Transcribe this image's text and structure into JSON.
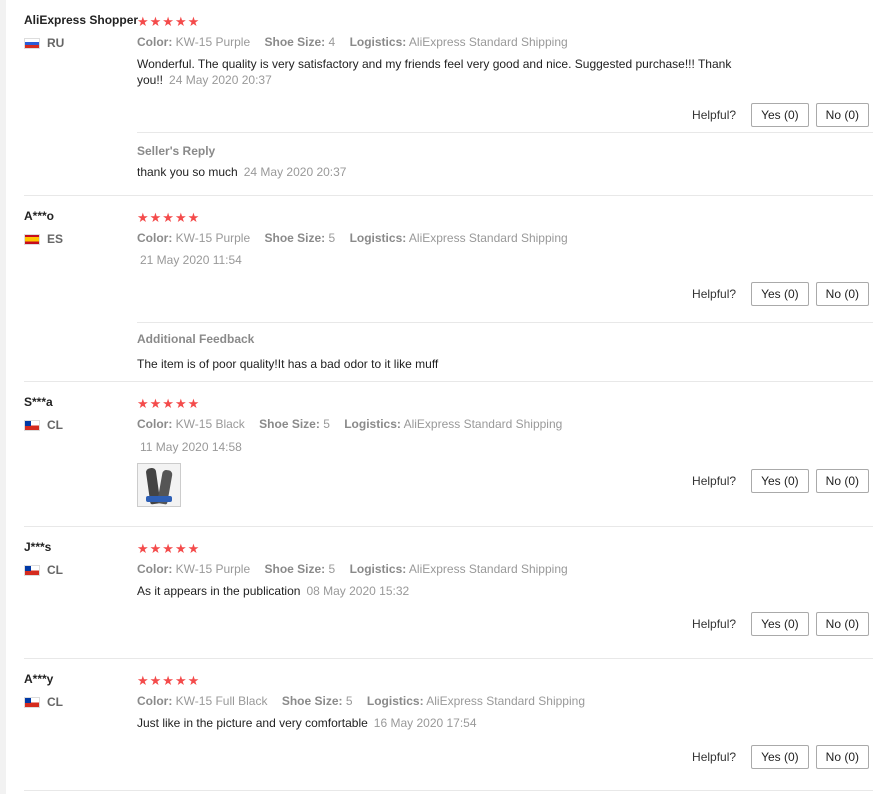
{
  "labels": {
    "color": "Color:",
    "shoe_size": "Shoe Size:",
    "logistics": "Logistics:",
    "helpful": "Helpful?",
    "yes": "Yes (0)",
    "no": "No (0)",
    "stars": "★★★★★"
  },
  "reviews": [
    {
      "user": "AliExpress Shopper",
      "country": "RU",
      "color": "KW-15 Purple",
      "shoe_size": "4",
      "logistics": "AliExpress Standard Shipping",
      "text": "Wonderful. The quality is very satisfactory and my friends feel very good and nice. Suggested purchase!!! Thank you!!",
      "date": "24 May 2020 20:37",
      "seller_reply": {
        "title": "Seller's Reply",
        "text": "thank you so much",
        "date": "24 May 2020 20:37"
      }
    },
    {
      "user": "A***o",
      "country": "ES",
      "color": "KW-15 Purple",
      "shoe_size": "5",
      "logistics": "AliExpress Standard Shipping",
      "text": "",
      "date": "21 May 2020 11:54",
      "additional_feedback": {
        "title": "Additional Feedback",
        "text": "The item is of poor quality!It has a bad odor to it like muff"
      }
    },
    {
      "user": "S***a",
      "country": "CL",
      "color": "KW-15 Black",
      "shoe_size": "5",
      "logistics": "AliExpress Standard Shipping",
      "text": "",
      "date": "11 May 2020 14:58"
    },
    {
      "user": "J***s",
      "country": "CL",
      "color": "KW-15 Purple",
      "shoe_size": "5",
      "logistics": "AliExpress Standard Shipping",
      "text": "As it appears in the publication",
      "date": "08 May 2020 15:32"
    },
    {
      "user": "A***y",
      "country": "CL",
      "color": "KW-15 Full Black",
      "shoe_size": "5",
      "logistics": "AliExpress Standard Shipping",
      "text": "Just like in the picture and very comfortable",
      "date": "16 May 2020 17:54"
    }
  ]
}
